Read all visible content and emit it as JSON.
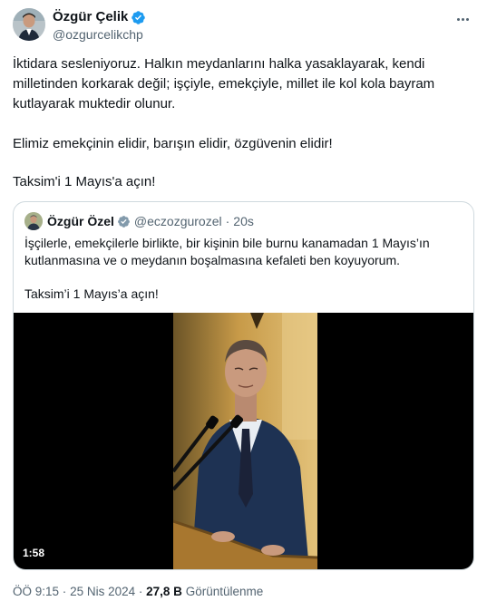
{
  "author": {
    "display_name": "Özgür Çelik",
    "handle": "@ozgurcelikchp"
  },
  "tweet": {
    "line1": "İktidara sesleniyoruz. Halkın meydanlarını halka yasaklayarak, kendi milletinden korkarak değil; işçiyle, emekçiyle, millet ile kol kola bayram kutlayarak muktedir olunur.",
    "line2": "Elimiz emekçinin elidir, barışın elidir, özgüvenin elidir!",
    "line3": "Taksim'i 1 Mayıs'a açın!"
  },
  "quoted": {
    "display_name": "Özgür Özel",
    "handle": "@eczozgurozel",
    "separator": "·",
    "time": "20s",
    "text1": "İşçilerle, emekçilerle birlikte, bir kişinin bile burnu kanamadan 1 Mayıs’ın kutlanmasına ve o meydanın boşalmasına kefaleti ben koyuyorum.",
    "text2": "Taksim’i 1 Mayıs’a açın!",
    "video_duration": "1:58"
  },
  "meta": {
    "time": "ÖÖ 9:15",
    "separator1": "·",
    "date": "25 Nis 2024",
    "separator2": "·",
    "views_count": "27,8 B",
    "views_label": "Görüntülenme"
  },
  "colors": {
    "verified": "#1d9bf0",
    "text": "#0f1419",
    "secondary": "#536471",
    "border": "#cfd9de"
  },
  "icons": {
    "verified": "verified-badge-icon",
    "more": "more-options-icon"
  }
}
